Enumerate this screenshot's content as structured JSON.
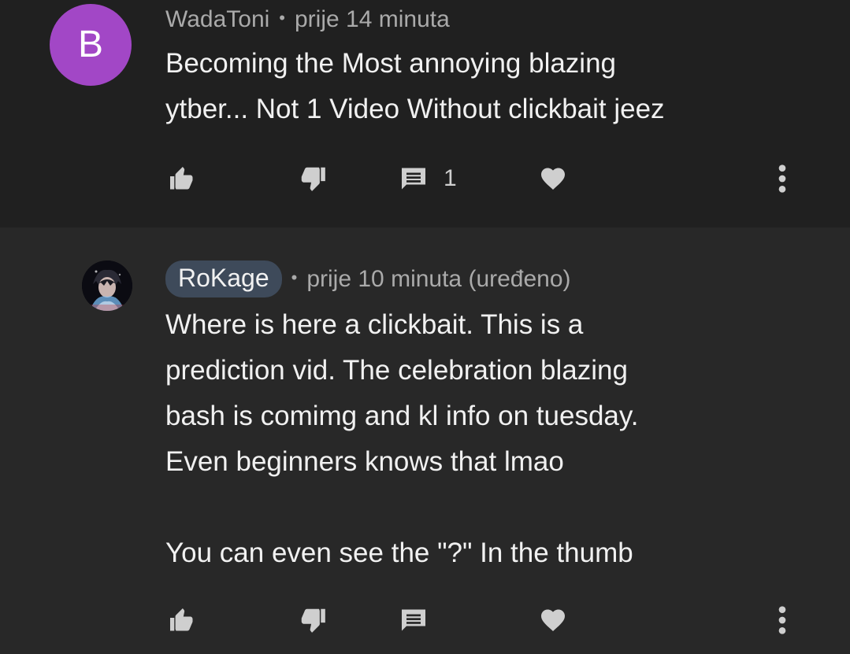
{
  "comments": [
    {
      "avatar_letter": "B",
      "author": "WadaToni",
      "time": "prije 14 minuta",
      "text": "Becoming the Most annoying blazing\nytber... Not 1 Video Without clickbait jeez",
      "reply_count": "1",
      "icons": [
        "thumbs-up-icon",
        "thumbs-down-icon",
        "reply-icon",
        "heart-icon",
        "more-icon"
      ]
    },
    {
      "author": "RoKage",
      "time": "prije 10 minuta (uređeno)",
      "text": "Where is here a clickbait. This is a\nprediction vid. The celebration blazing\nbash is comimg and kl info on tuesday.\nEven beginners knows that lmao\n\nYou can even see the \"?\" In the thumb",
      "reply_count": "",
      "icons": [
        "thumbs-up-icon",
        "thumbs-down-icon",
        "reply-icon",
        "heart-icon",
        "more-icon"
      ]
    }
  ],
  "colors": {
    "background_first": "#202020",
    "background_second": "#282828",
    "avatar_purple": "#a247c6",
    "author_pill": "#3e4a5a",
    "meta_text": "#aaaaaa",
    "body_text": "#f1f1f1"
  }
}
